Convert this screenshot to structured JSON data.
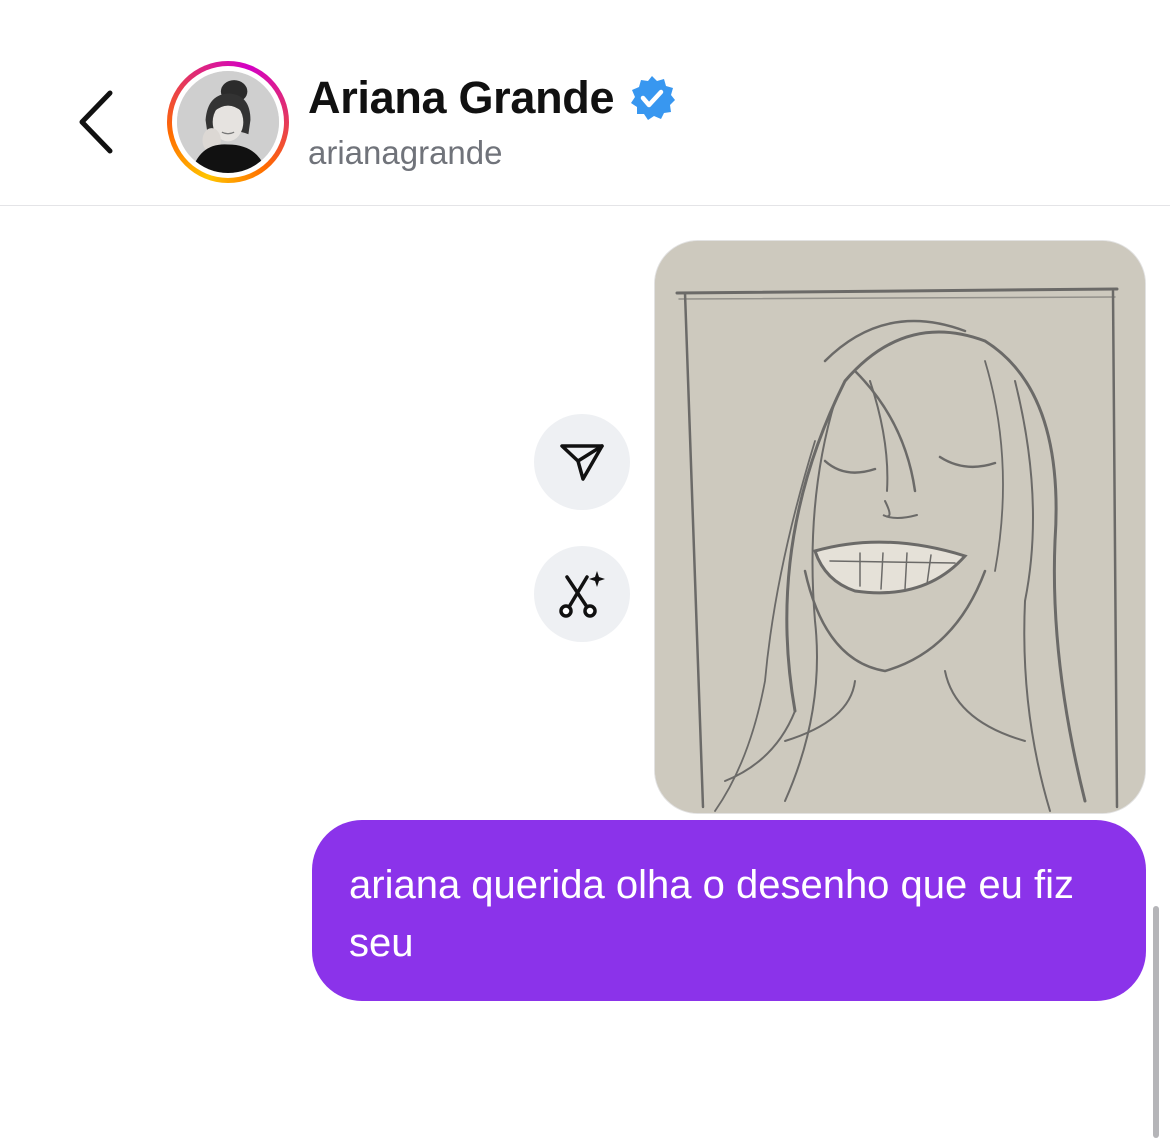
{
  "header": {
    "name": "Ariana Grande",
    "handle": "arianagrande",
    "verified": true,
    "verified_color": "#3897f0",
    "back_icon": "chevron-left-icon"
  },
  "conversation": {
    "photo_message": {
      "description_icon": "image-attachment",
      "actions": [
        {
          "icon": "share-icon"
        },
        {
          "icon": "remix-icon"
        }
      ]
    },
    "text_message": {
      "text": "ariana querida olha o desenho que eu fiz seu",
      "bubble_color": "#8b33ea"
    }
  }
}
